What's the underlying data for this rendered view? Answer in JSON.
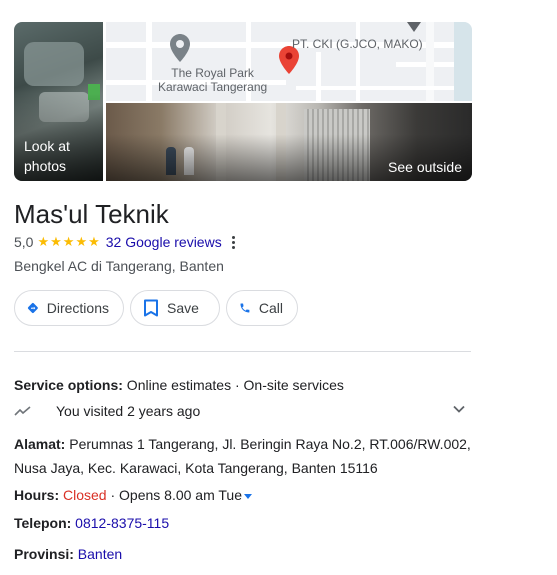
{
  "photos": {
    "left_label_line1": "Look at",
    "left_label_line2": "photos",
    "right_label": "See outside"
  },
  "map": {
    "park_label_line1": "The Royal Park",
    "park_label_line2": "Karawaci Tangerang",
    "cki_label": "PT. CKI (G.JCO, MAKO)"
  },
  "business": {
    "name": "Mas'ul Teknik",
    "rating": "5,0",
    "stars": 5,
    "reviews": "32 Google reviews",
    "category": "Bengkel AC di Tangerang, Banten"
  },
  "actions": {
    "directions": "Directions",
    "save": "Save",
    "call": "Call"
  },
  "details": {
    "service_label": "Service options:",
    "service_value": " Online estimates · On-site services",
    "visited": "You visited 2 years ago",
    "address_label": "Alamat:",
    "address_value": " Perumnas 1 Tangerang, Jl. Beringin Raya No.2, RT.006/RW.002, Nusa Jaya, Kec. Karawaci, Kota Tangerang, Banten 15116",
    "hours_label": "Hours:",
    "hours_status": " Closed",
    "hours_next": " · Opens 8.00 am Tue",
    "phone_label": "Telepon:",
    "phone_value": " 0812-8375-115",
    "province_label": "Provinsi:",
    "province_value": " Banten"
  },
  "colors": {
    "star": "#fbbc04",
    "link": "#1a0dab",
    "closed": "#d93025",
    "accent": "#1a73e8"
  }
}
